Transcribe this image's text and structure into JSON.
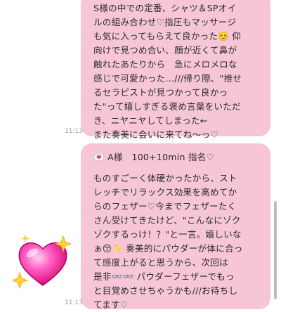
{
  "messages": [
    {
      "lines": [
        "S様の中での定番、シャツ＆SPオイ",
        "ルの組み合わせ♡指圧もマッサージ",
        "も気に入ってもらえて良かった☺️ 仰",
        "向けで見つめ合い、顔が近くて鼻が",
        "触れたあたりから　急にメロメロな",
        "感じで可愛かった…///帰り際、\"推せ",
        "るセラピストが見つかって良かっ",
        "た\"って嬉しすぎる褒め言葉をいただ",
        "き、ニヤニヤしてしまった←",
        "また奏美に会いに来てね〜っ♡"
      ],
      "time": "11:13"
    },
    {
      "header": "💌 A様　100+10min 指名♡",
      "lines": [
        "ものすごーく体硬かったから、スト",
        "レッチでリラックス効果を高めてか",
        "らのフェザー♡今までフェザーたく",
        "さん受けてきたけど、\"こんなにゾク",
        "ゾクするっけ！？\"と一言。嬉しいな",
        "ぁ😚✨ 奏美的にパウダーが体に合っ",
        "て感度上がると思うから、次回は",
        "是非👓👓 パウダーフェザーでもっ",
        "と目覚めさせちゃうかも///お待ちし",
        "てます♡"
      ],
      "time": "11:13"
    }
  ],
  "colors": {
    "bubble": "#f6c6d6",
    "text": "#2b2b2b",
    "timestamp": "#9a9a9a"
  },
  "icons": {
    "reaction_sticker": "sparkling-heart-icon"
  }
}
